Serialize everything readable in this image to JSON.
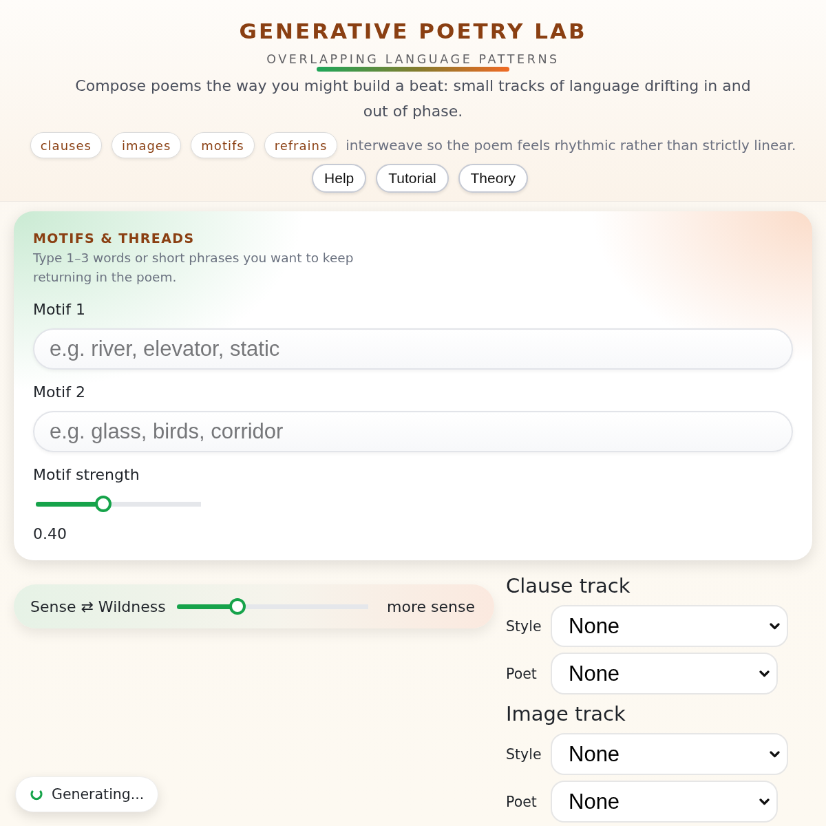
{
  "header": {
    "title": "GENERATIVE POETRY LAB",
    "subtitle": "OVERLAPPING LANGUAGE PATTERNS",
    "intro": "Compose poems the way you might build a beat: small tracks of language drifting in and out of phase.",
    "chips": [
      "clauses",
      "images",
      "motifs",
      "refrains"
    ],
    "chips_caption": "interweave so the poem feels rhythmic rather than strictly linear.",
    "buttons": [
      "Help",
      "Tutorial",
      "Theory"
    ]
  },
  "motifs_panel": {
    "title": "MOTIFS & THREADS",
    "hint": "Type 1–3 words or short phrases you want to keep returning in the poem.",
    "fields": [
      {
        "label": "Motif 1",
        "placeholder": "e.g. river, elevator, static"
      },
      {
        "label": "Motif 2",
        "placeholder": "e.g. glass, birds, corridor"
      }
    ],
    "strength": {
      "label": "Motif strength",
      "level": 0.4,
      "reading": "0.40"
    }
  },
  "sense_slider": {
    "label": "Sense ⇄ Wildness",
    "level": 0.3,
    "reading": "more sense"
  },
  "tracks": [
    {
      "title": "Clause track",
      "selects": [
        {
          "label": "Style",
          "value": "None"
        },
        {
          "label": "Poet",
          "value": "None"
        }
      ]
    },
    {
      "title": "Image track",
      "selects": [
        {
          "label": "Style",
          "value": "None"
        },
        {
          "label": "Poet",
          "value": "None"
        }
      ]
    }
  ],
  "status": {
    "text": "Generating..."
  }
}
